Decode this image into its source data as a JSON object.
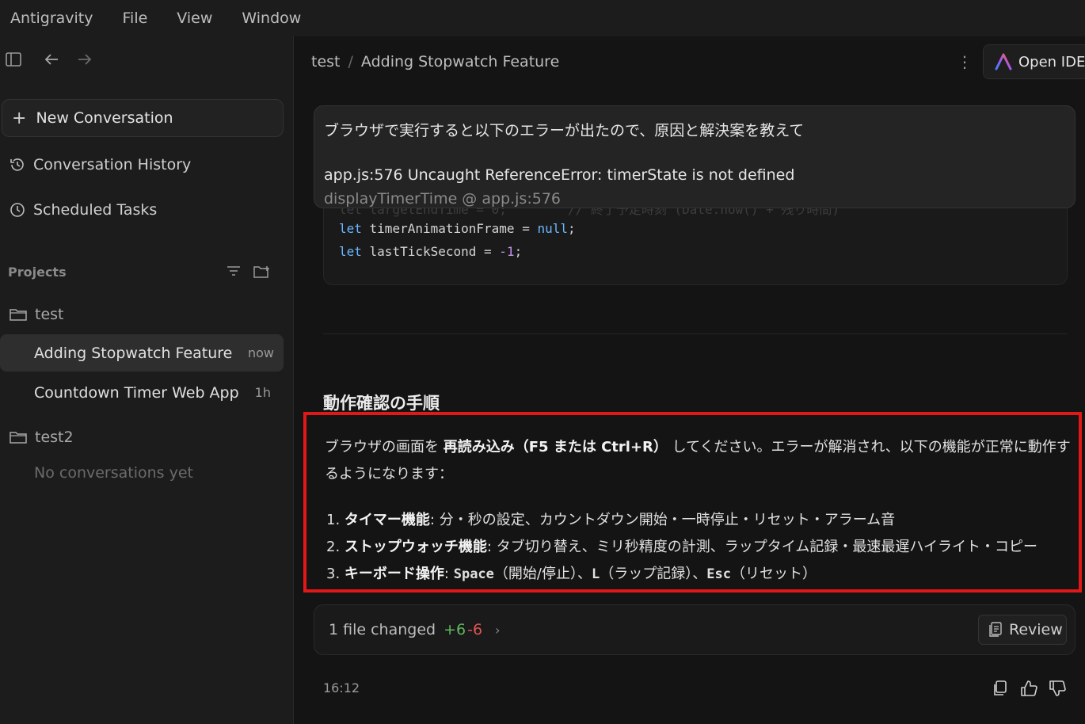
{
  "menubar": {
    "items": [
      "Antigravity",
      "File",
      "View",
      "Window"
    ]
  },
  "sidebar": {
    "new_conversation": "New Conversation",
    "conversation_history": "Conversation History",
    "scheduled_tasks": "Scheduled Tasks",
    "projects_label": "Projects",
    "projects": [
      {
        "name": "test",
        "conversations": [
          {
            "title": "Adding Stopwatch Feature",
            "time": "now",
            "active": true
          },
          {
            "title": "Countdown Timer Web App",
            "time": "1h",
            "active": false
          }
        ]
      },
      {
        "name": "test2",
        "empty_text": "No conversations yet"
      }
    ]
  },
  "header": {
    "breadcrumb_project": "test",
    "breadcrumb_sep": "/",
    "breadcrumb_title": "Adding Stopwatch Feature",
    "open_ide": "Open IDE"
  },
  "user_message": {
    "line1": "ブラウザで実行すると以下のエラーが出たので、原因と解決案を教えて",
    "line2": "app.js:576 Uncaught ReferenceError: timerState is not defined",
    "line3": "displayTimerTime @ app.js:576"
  },
  "code": {
    "faded_line": "let targetEndTime = 0;        // 終了予定時刻 (Date.now() + 残り時間)",
    "line1_kw": "let",
    "line1_rest": " timerAnimationFrame = ",
    "line1_val": "null",
    "line1_end": ";",
    "line2_kw": "let",
    "line2_rest": " lastTickSecond = ",
    "line2_val": "-1",
    "line2_end": ";"
  },
  "response": {
    "section_title": "動作確認の手順",
    "para_pre": "ブラウザの画面を ",
    "para_bold": "再読み込み（F5 または Ctrl+R）",
    "para_post": " してください。エラーが解消され、以下の機能が正常に動作するようになります：",
    "list": [
      {
        "num": "1.",
        "label": "タイマー機能",
        "text": ": 分・秒の設定、カウントダウン開始・一時停止・リセット・アラーム音"
      },
      {
        "num": "2.",
        "label": "ストップウォッチ機能",
        "text": ": タブ切り替え、ミリ秒精度の計測、ラップタイム記録・最速最遅ハイライト・コピー"
      },
      {
        "num": "3.",
        "label": "キーボード操作",
        "key1": "Space",
        "t1": "（開始/停止）、",
        "key2": "L",
        "t2": "（ラップ記録）、",
        "key3": "Esc",
        "t3": "（リセット）"
      }
    ]
  },
  "files": {
    "label": "1 file changed",
    "added": "+6",
    "removed": "-6",
    "review": "Review"
  },
  "footer": {
    "time": "16:12"
  },
  "colors": {
    "highlight_border": "#e01818",
    "added": "#5fb85f",
    "removed": "#e05555",
    "keyword": "#6cb6ff"
  }
}
